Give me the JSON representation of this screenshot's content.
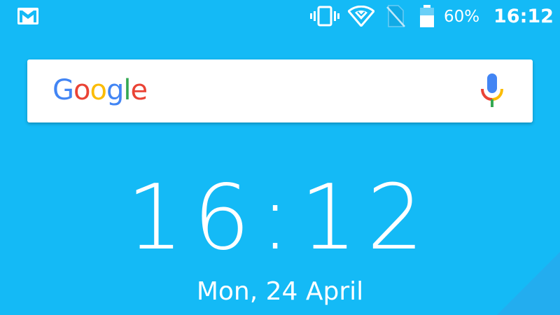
{
  "status_bar": {
    "icons": [
      "gmail-icon",
      "vibrate-icon",
      "wifi-icon",
      "no-sim-icon",
      "battery-icon"
    ],
    "battery_percent": "60%",
    "battery_level": 0.6,
    "time": "16:12"
  },
  "search": {
    "logo_letters": [
      {
        "char": "G",
        "color": "#4285F4"
      },
      {
        "char": "o",
        "color": "#EA4335"
      },
      {
        "char": "o",
        "color": "#FBBC05"
      },
      {
        "char": "g",
        "color": "#4285F4"
      },
      {
        "char": "l",
        "color": "#34A853"
      },
      {
        "char": "e",
        "color": "#EA4335"
      }
    ],
    "mic_icon": "mic-icon"
  },
  "clock": {
    "time": "16:12",
    "date": "Mon, 24 April"
  },
  "colors": {
    "background": "#14baf6",
    "corner_accent": "#2fa3ea"
  }
}
